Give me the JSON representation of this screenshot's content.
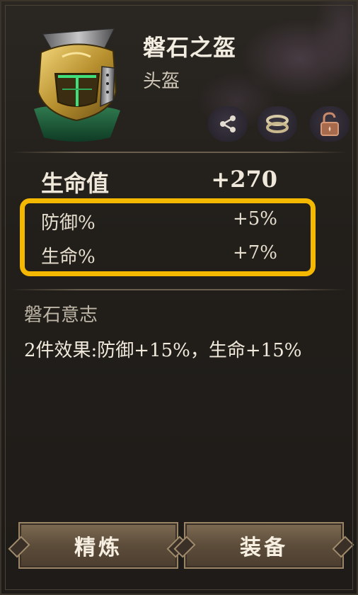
{
  "item": {
    "name": "磐石之盔",
    "type": "头盔"
  },
  "icons": {
    "share": "share-icon",
    "ring": "ring-icon",
    "lock": "unlock-icon"
  },
  "stats": {
    "main": {
      "label": "生命值",
      "value": "+270"
    },
    "sub": [
      {
        "label": "防御%",
        "value": "+5%"
      },
      {
        "label": "生命%",
        "value": "+7%"
      }
    ]
  },
  "set": {
    "title": "磐石意志",
    "description": "2件效果:防御+15%，生命+15%"
  },
  "buttons": {
    "refine": "精炼",
    "equip": "装备"
  },
  "colors": {
    "highlight": "#f5b800",
    "background": "#221f1b",
    "text": "#f0e9dc"
  }
}
